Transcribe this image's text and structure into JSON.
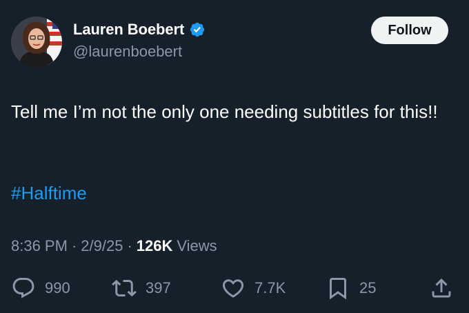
{
  "author": {
    "display_name": "Lauren Boebert",
    "handle": "@laurenboebert",
    "verified": true
  },
  "follow_label": "Follow",
  "tweet": {
    "text": "Tell me I’m not the only one needing subtitles for this!!",
    "hashtag": "#Halftime"
  },
  "meta": {
    "time": "8:36 PM",
    "date": "2/9/25",
    "views_count": "126K",
    "views_label": "Views",
    "separator": "·"
  },
  "actions": {
    "replies": "990",
    "retweets": "397",
    "likes": "7.7K",
    "bookmarks": "25"
  },
  "icons": {
    "reply": "reply-icon",
    "retweet": "retweet-icon",
    "like": "heart-icon",
    "bookmark": "bookmark-icon",
    "share": "share-icon",
    "verified": "verified-badge-icon"
  },
  "colors": {
    "background": "#15202b",
    "text": "#ffffff",
    "secondary_text": "#8b98a5",
    "link": "#1d9bf0",
    "follow_button": "#eff3f4",
    "verified_badge": "#1d9bf0"
  }
}
